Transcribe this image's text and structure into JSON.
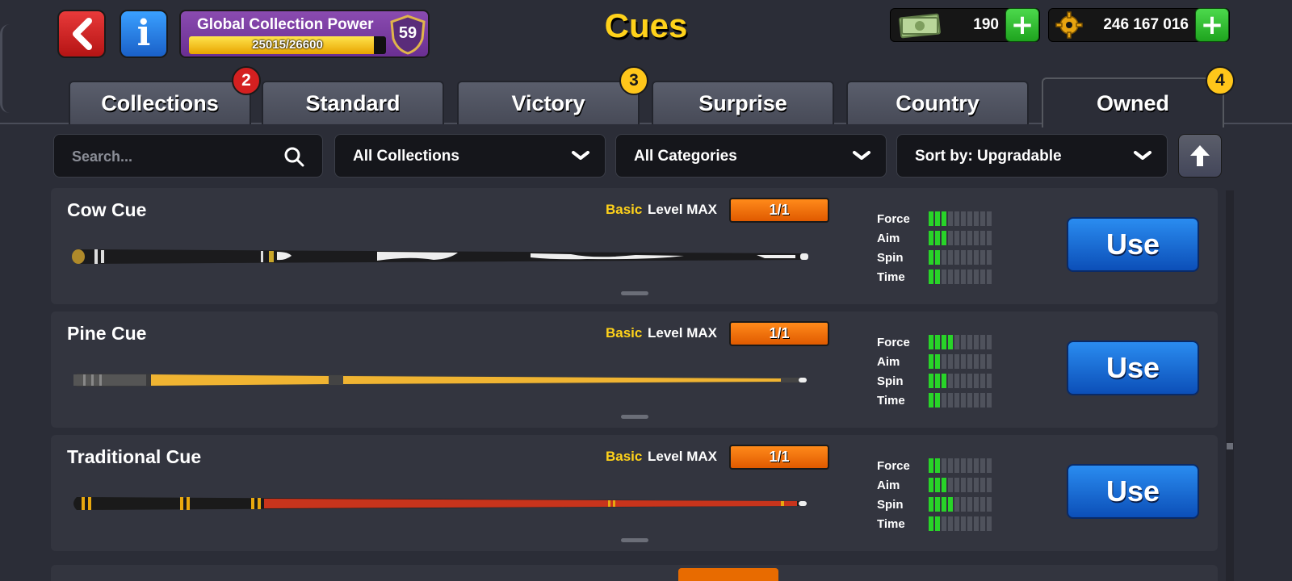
{
  "header": {
    "title": "Cues",
    "back_icon": "back-arrow-icon",
    "info_icon": "info-icon",
    "info_glyph": "i",
    "collection_power": {
      "label": "Global Collection Power",
      "current": 25015,
      "max": 26600,
      "progress_text": "25015/26600",
      "level": "59"
    },
    "currencies": [
      {
        "name": "cash",
        "icon": "cash-icon",
        "amount": "190",
        "add_label": "+"
      },
      {
        "name": "coins",
        "icon": "coins-gear-icon",
        "amount": "246 167 016",
        "add_label": "+"
      }
    ]
  },
  "tabs": [
    {
      "label": "Collections",
      "badge": "2",
      "badge_color": "red",
      "active": false
    },
    {
      "label": "Standard",
      "badge": null,
      "active": false
    },
    {
      "label": "Victory",
      "badge": "3",
      "badge_color": "yellow",
      "active": false
    },
    {
      "label": "Surprise",
      "badge": null,
      "active": false
    },
    {
      "label": "Country",
      "badge": null,
      "active": false
    },
    {
      "label": "Owned",
      "badge": "4",
      "badge_color": "yellow",
      "active": true
    }
  ],
  "filters": {
    "search_placeholder": "Search...",
    "collections": "All Collections",
    "categories": "All Categories",
    "sort": "Sort by: Upgradable",
    "sort_direction_icon": "arrow-up-icon"
  },
  "stat_labels": [
    "Force",
    "Aim",
    "Spin",
    "Time"
  ],
  "cues": [
    {
      "name": "Cow Cue",
      "rarity": "Basic",
      "level": "Level MAX",
      "progress": "1/1",
      "stats": {
        "Force": 3,
        "Aim": 3,
        "Spin": 2,
        "Time": 2
      },
      "action": "Use"
    },
    {
      "name": "Pine Cue",
      "rarity": "Basic",
      "level": "Level MAX",
      "progress": "1/1",
      "stats": {
        "Force": 4,
        "Aim": 2,
        "Spin": 3,
        "Time": 2
      },
      "action": "Use"
    },
    {
      "name": "Traditional Cue",
      "rarity": "Basic",
      "level": "Level MAX",
      "progress": "1/1",
      "stats": {
        "Force": 2,
        "Aim": 3,
        "Spin": 4,
        "Time": 2
      },
      "action": "Use"
    }
  ],
  "stat_max": 10,
  "colors": {
    "title": "#ffd21a",
    "rarity": "#ffd21a",
    "stat_on": "#28d428",
    "use_button": "#1a6ad8",
    "progress_pill": "#ff7a10"
  }
}
